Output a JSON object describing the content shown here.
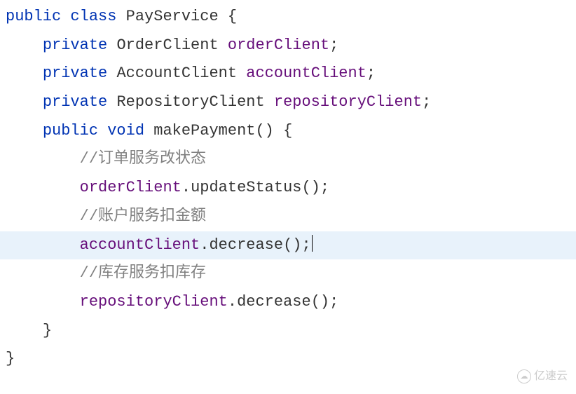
{
  "code": {
    "line1": {
      "kw_public": "public",
      "kw_class": "class",
      "classname": "PayService",
      "brace": " {"
    },
    "line2": {
      "kw_private": "private",
      "type": "OrderClient",
      "field": "orderClient",
      "semi": ";"
    },
    "line3": {
      "kw_private": "private",
      "type": "AccountClient",
      "field": "accountClient",
      "semi": ";"
    },
    "line4": {
      "kw_private": "private",
      "type": "RepositoryClient",
      "field": "repositoryClient",
      "semi": ";"
    },
    "line5": {
      "kw_public": "public",
      "kw_void": "void",
      "method": "makePayment",
      "parens_brace": "() {"
    },
    "line6": {
      "comment": "//订单服务改状态"
    },
    "line7": {
      "field": "orderClient",
      "dot": ".",
      "method": "updateStatus",
      "call": "();"
    },
    "line8": {
      "comment": "//账户服务扣金额"
    },
    "line9": {
      "field": "accountClient",
      "dot": ".",
      "method": "decrease",
      "call": "();"
    },
    "line10": {
      "comment": "//库存服务扣库存"
    },
    "line11": {
      "field": "repositoryClient",
      "dot": ".",
      "method": "decrease",
      "call": "();"
    },
    "line12": {
      "brace": "}"
    },
    "line13": {
      "brace": "}"
    }
  },
  "watermark": {
    "text": "亿速云"
  }
}
